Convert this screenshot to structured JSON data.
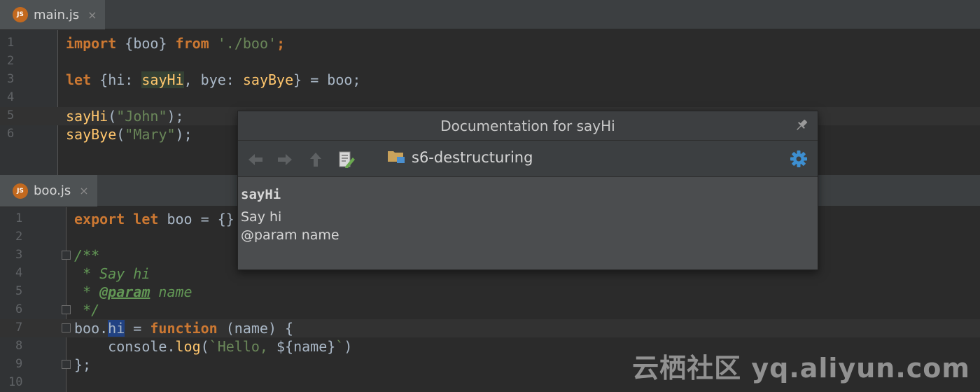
{
  "tabs": {
    "main": {
      "badge": "JS",
      "label": "main.js",
      "close": "×"
    },
    "boo": {
      "badge": "JS",
      "label": "boo.js",
      "close": "×"
    }
  },
  "main_editor": {
    "line_numbers": [
      "1",
      "2",
      "3",
      "4",
      "5",
      "6"
    ],
    "line1": {
      "kw1": "import",
      "mid": " {boo} ",
      "kw2": "from",
      "sp": " ",
      "str": "'./boo'",
      "end": ";"
    },
    "line3": {
      "kw": "let",
      "a": " {hi: ",
      "w1": "sayHi",
      "b": ", bye: ",
      "w2": "sayBye",
      "c": "} = boo;"
    },
    "line5": {
      "fn": "sayHi",
      "open": "(",
      "str": "\"John\"",
      "close": ");"
    },
    "line6": {
      "fn": "sayBye",
      "open": "(",
      "str": "\"Mary\"",
      "close": ");"
    }
  },
  "boo_editor": {
    "line_numbers": [
      "1",
      "2",
      "3",
      "4",
      "5",
      "6",
      "7",
      "8",
      "9",
      "10"
    ],
    "line1": {
      "kw1": "export",
      "sp": " ",
      "kw2": "let",
      "rest": " boo = {}"
    },
    "line3": {
      "doc": "/**"
    },
    "line4": {
      "doc": " * Say hi"
    },
    "line5": {
      "star": " * ",
      "tag": "@param",
      "name": " name"
    },
    "line6": {
      "doc": " */"
    },
    "line7": {
      "a": "boo.",
      "sel": "hi",
      "b": " = ",
      "kw": "function",
      "c": " (name) {"
    },
    "line8": {
      "a": "    console.",
      "fn": "log",
      "b": "(",
      "str": "`Hello, ",
      "interp": "${name}",
      "str2": "`",
      "c": ")"
    },
    "line9": {
      "a": "};"
    }
  },
  "doc_popup": {
    "title": "Documentation for sayHi",
    "path": "s6-destructuring",
    "name": "sayHi",
    "description": "Say hi",
    "param": "@param name",
    "icons": [
      "back-icon",
      "forward-icon",
      "up-icon",
      "edit-source-icon",
      "folder-icon",
      "gear-icon",
      "pin-icon"
    ]
  },
  "watermark": "云栖社区 yq.aliyun.com",
  "colors": {
    "background": "#2b2b2b",
    "keyword": "#cc7832",
    "string": "#6a8759",
    "function": "#ffc66d",
    "doc_comment": "#629755",
    "default_text": "#a9b7c6"
  }
}
